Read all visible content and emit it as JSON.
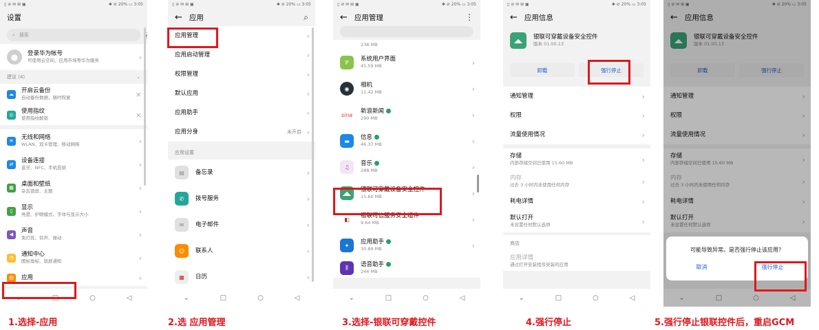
{
  "status": {
    "left": "▯ ⊘ ✉ ⊞ ▣",
    "right": "✱ ⊘ 20% ▭ 3:05"
  },
  "panel1": {
    "title": "设置",
    "search_placeholder": "搜索",
    "account": {
      "title": "登录华为帐号",
      "sub": "可使用云空间、应用市场等华为服务"
    },
    "suggest_header": "建议 (4)",
    "suggest": [
      {
        "title": "开启云备份",
        "sub": "自动备份数据，随时恢复"
      },
      {
        "title": "使用指纹",
        "sub": "使用指纹解锁"
      }
    ],
    "items": [
      {
        "title": "无线和网络",
        "sub": "WLAN、双卡管理、移动网络"
      },
      {
        "title": "设备连接",
        "sub": "蓝牙、NFC、手机投屏"
      },
      {
        "title": "桌面和壁纸",
        "sub": "杂志锁屏、主题"
      },
      {
        "title": "显示",
        "sub": "亮度、护眼模式、字体与显示大小"
      },
      {
        "title": "声音",
        "sub": "免打扰、铃声、振动"
      },
      {
        "title": "通知中心",
        "sub": "图标角标、锁屏通知"
      },
      {
        "title": "应用",
        "sub": ""
      }
    ],
    "caption": "1.选择-应用"
  },
  "panel2": {
    "title": "应用",
    "items": [
      "应用管理",
      "应用启动管理",
      "权限管理",
      "默认应用",
      "应用助手",
      "应用分身"
    ],
    "app_clone_status": "未开启",
    "section": "应用设置",
    "apps": [
      "备忘录",
      "拨号服务",
      "电子邮件",
      "联系人",
      "日历"
    ],
    "caption": "2.选 应用管理"
  },
  "panel3": {
    "title": "应用管理",
    "top_size": "238 MB",
    "apps": [
      {
        "name": "系统用户界面",
        "size": "45.59 MB",
        "color": "#8bc34a"
      },
      {
        "name": "相机",
        "size": "11.42 MB",
        "color": "#263238"
      },
      {
        "name": "新浪新闻",
        "size": "290 MB",
        "color": "#e53935"
      },
      {
        "name": "信息",
        "size": "46.37 MB",
        "color": "#1e88e5"
      },
      {
        "name": "音乐",
        "size": "288 MB",
        "color": "#ab47bc"
      },
      {
        "name": "银联可穿戴设备安全控件",
        "size": "15.60 MB",
        "color": "#3aa376"
      },
      {
        "name": "银联可信服务安全组件",
        "size": "9.64 MB",
        "color": "#c62828"
      },
      {
        "name": "应用助手",
        "size": "30.89 MB",
        "color": "#1976d2"
      },
      {
        "name": "语音助手",
        "size": "244 MB",
        "color": "#5e35b1"
      }
    ],
    "caption": "3.选择-银联可穿戴控件"
  },
  "panel4": {
    "title": "应用信息",
    "app_name": "银联可穿戴设备安全控件",
    "version": "版本 01.00.13",
    "uninstall": "卸载",
    "force_stop": "强行停止",
    "rows": [
      {
        "title": "通知管理",
        "sub": ""
      },
      {
        "title": "权限",
        "sub": ""
      },
      {
        "title": "流量使用情况",
        "sub": ""
      },
      {
        "title": "存储",
        "sub": "内部存储空间已使用 15.60 MB"
      },
      {
        "title": "内存",
        "sub": "过去 3 小时内未使用任何内存"
      },
      {
        "title": "耗电详情",
        "sub": ""
      },
      {
        "title": "默认打开",
        "sub": "未设置任何默认选项"
      }
    ],
    "store_section": "商店",
    "store_row": {
      "title": "应用详情",
      "sub": "通过打开安装程序安装的应用"
    },
    "caption": "4.强行停止"
  },
  "panel5": {
    "title": "应用信息",
    "app_name": "银联可穿戴设备安全控件",
    "version": "版本 01.00.13",
    "uninstall": "卸载",
    "force_stop": "强行停止",
    "rows": [
      {
        "title": "通知管理",
        "sub": ""
      },
      {
        "title": "权限",
        "sub": ""
      },
      {
        "title": "流量使用情况",
        "sub": ""
      },
      {
        "title": "存储",
        "sub": "内部存储空间已使用 15.60 MB"
      },
      {
        "title": "内存",
        "sub": "过去 3 小时内未使用任何内存"
      },
      {
        "title": "耗电详情",
        "sub": ""
      },
      {
        "title": "默认打开",
        "sub": "未设置任何默认选项"
      }
    ],
    "dialog": {
      "message": "可能导致异常。是否强行停止该应用？",
      "cancel": "取消",
      "confirm": "强行停止"
    },
    "caption": "5.强行停止银联控件后，重启GCM"
  },
  "nav": {
    "back": "◁",
    "home": "○",
    "recent": "□",
    "down": "⌄"
  }
}
